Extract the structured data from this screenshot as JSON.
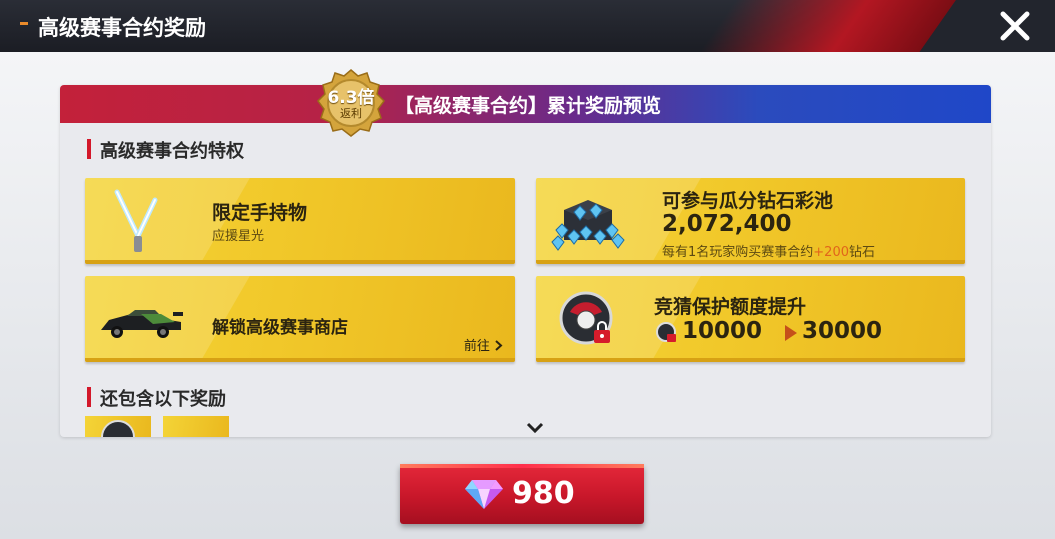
{
  "header": {
    "title": "高级赛事合约奖励"
  },
  "banner": {
    "title": "【高级赛事合约】累计奖励预览",
    "medal_value": "6.3倍",
    "medal_label": "返利"
  },
  "sections": {
    "privileges_title": "高级赛事合约特权",
    "extras_title": "还包含以下奖励"
  },
  "tiles": {
    "handheld": {
      "title": "限定手持物",
      "subtitle": "应援星光"
    },
    "diamond_pool": {
      "title": "可参与瓜分钻石彩池",
      "amount": "2,072,400",
      "desc_prefix": "每有1名玩家购买赛事合约",
      "desc_bonus": "+200",
      "desc_suffix": "钻石"
    },
    "shop": {
      "title": "解锁高级赛事商店",
      "link": "前往"
    },
    "guess": {
      "title": "竞猜保护额度提升",
      "from": "10000",
      "to": "30000"
    }
  },
  "buy": {
    "price": "980"
  },
  "colors": {
    "accent_red": "#d3182a",
    "gold": "#f1c82a",
    "orange": "#e1651b"
  },
  "icons": [
    "close-icon",
    "lightsaber-icon",
    "diamond-pile-icon",
    "race-car-icon",
    "protection-badge-icon",
    "lock-icon",
    "chevron-right-icon",
    "chevron-down-icon",
    "gem-icon"
  ]
}
